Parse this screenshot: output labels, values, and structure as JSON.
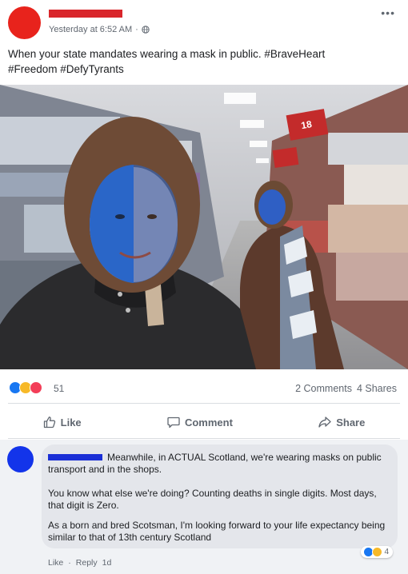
{
  "post": {
    "timestamp": "Yesterday at 6:52 AM",
    "separator": "·",
    "privacy_icon": "globe-icon",
    "more_icon": "ellipsis-icon",
    "caption_line1": "When your state mandates wearing a mask in public. #BraveHeart",
    "caption_line2": "#Freedom #DefyTyrants",
    "avatar_color": "#e8231c",
    "redaction_color": "#d9262b"
  },
  "photo": {
    "sign_text": "18"
  },
  "reactions": {
    "icons": [
      "like-icon",
      "haha-icon",
      "love-icon"
    ],
    "count": "51",
    "comments": "2 Comments",
    "shares": "4 Shares"
  },
  "actions": {
    "like_label": "Like",
    "comment_label": "Comment",
    "share_label": "Share"
  },
  "comment": {
    "avatar_color": "#1334ea",
    "redaction_color": "#1a2fd6",
    "para1": "Meanwhile, in ACTUAL Scotland, we're wearing masks on public transport and in the shops.",
    "para2": "You know what else we're doing? Counting deaths in single digits. Most days, that digit is Zero.",
    "para3": "As a born and bred Scotsman, I'm looking forward to your life expectancy being similar to that of 13th century Scotland",
    "reaction_icons": [
      "like-icon",
      "haha-icon"
    ],
    "reaction_count": "4",
    "like_label": "Like",
    "dot": "·",
    "reply_label": "Reply",
    "age": "1d"
  }
}
